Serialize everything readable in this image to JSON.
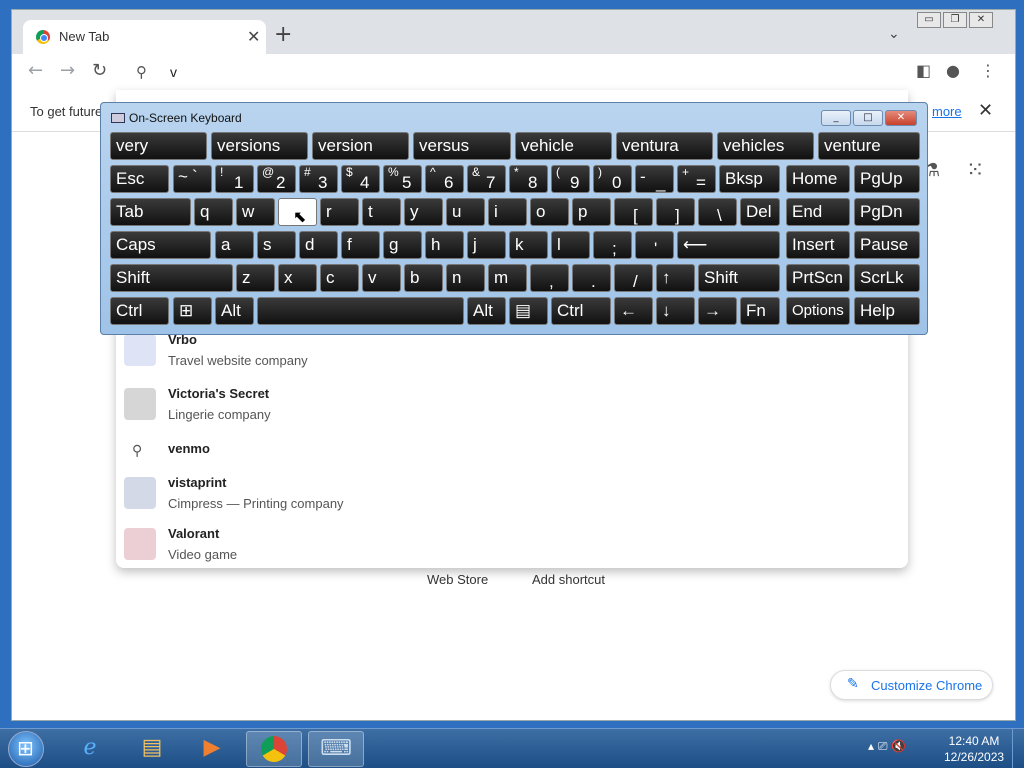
{
  "browser": {
    "tab_title": "New Tab",
    "omnibox_value": "v",
    "infobar_text": "To get future",
    "infobar_link": "more",
    "window_controls": [
      "▭",
      "❐",
      "✕"
    ]
  },
  "suggestions": [
    {
      "name": "Vrbo",
      "desc": "Travel website company",
      "thumb_color": "#dfe3f6",
      "type": "entity"
    },
    {
      "name": "Victoria's Secret",
      "desc": "Lingerie company",
      "thumb_color": "#d6d6d6",
      "type": "entity"
    },
    {
      "name": "venmo",
      "desc": "",
      "thumb_color": "",
      "type": "search"
    },
    {
      "name": "vistaprint",
      "desc": "Cimpress — Printing company",
      "thumb_color": "#d3d9e6",
      "type": "entity"
    },
    {
      "name": "Valorant",
      "desc": "Video game",
      "thumb_color": "#eccfd5",
      "type": "entity"
    }
  ],
  "ntp": {
    "shortcut_1": "Web Store",
    "shortcut_2": "Add shortcut",
    "customize_label": "Customize Chrome"
  },
  "osk": {
    "title": "On-Screen Keyboard",
    "predictions": [
      "very",
      "versions",
      "version",
      "versus",
      "vehicle",
      "ventura",
      "vehicles",
      "venture"
    ],
    "row1": [
      {
        "top": "",
        "main": "Esc"
      },
      {
        "top": "~",
        "main": "`"
      },
      {
        "top": "!",
        "main": "1"
      },
      {
        "top": "@",
        "main": "2"
      },
      {
        "top": "#",
        "main": "3"
      },
      {
        "top": "$",
        "main": "4"
      },
      {
        "top": "%",
        "main": "5"
      },
      {
        "top": "^",
        "main": "6"
      },
      {
        "top": "&",
        "main": "7"
      },
      {
        "top": "*",
        "main": "8"
      },
      {
        "top": "(",
        "main": "9"
      },
      {
        "top": ")",
        "main": "0"
      },
      {
        "top": "-",
        "main": "_"
      },
      {
        "top": "+",
        "main": "="
      },
      {
        "top": "",
        "main": "Bksp"
      },
      {
        "top": "",
        "main": "Home"
      },
      {
        "top": "",
        "main": "PgUp"
      }
    ],
    "row2": [
      "Tab",
      "q",
      "w",
      "e",
      "r",
      "t",
      "y",
      "u",
      "i",
      "o",
      "p",
      "[",
      "]",
      "\\",
      "Del",
      "End",
      "PgDn"
    ],
    "row3": [
      "Caps",
      "a",
      "s",
      "d",
      "f",
      "g",
      "h",
      "j",
      "k",
      "l",
      ";",
      "'",
      "⟵",
      "Insert",
      "Pause"
    ],
    "row4": [
      "Shift",
      "z",
      "x",
      "c",
      "v",
      "b",
      "n",
      "m",
      ",",
      ".",
      "/",
      "↑",
      "Shift",
      "PrtScn",
      "ScrLk"
    ],
    "row5": [
      "Ctrl",
      "⊞",
      "Alt",
      "",
      "Alt",
      "▤",
      "Ctrl",
      "←",
      "↓",
      "→",
      "Fn",
      "Options",
      "Help"
    ]
  },
  "taskbar": {
    "time": "12:40 AM",
    "date": "12/26/2023"
  }
}
